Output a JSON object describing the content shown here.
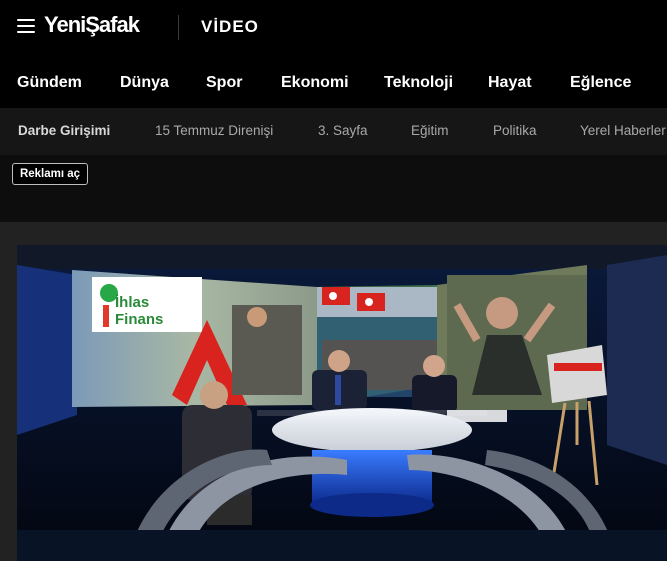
{
  "header": {
    "logo": "YeniŞafak",
    "section": "VİDEO"
  },
  "main_nav": [
    {
      "label": "Gündem"
    },
    {
      "label": "Dünya"
    },
    {
      "label": "Spor"
    },
    {
      "label": "Ekonomi"
    },
    {
      "label": "Teknoloji"
    },
    {
      "label": "Hayat"
    },
    {
      "label": "Eğlence"
    }
  ],
  "sub_nav": [
    {
      "label": "Darbe Girişimi",
      "active": true
    },
    {
      "label": "15 Temmuz Direnişi"
    },
    {
      "label": "3. Sayfa"
    },
    {
      "label": "Eğitim"
    },
    {
      "label": "Politika"
    },
    {
      "label": "Yerel Haberler"
    }
  ],
  "ad": {
    "button_label": "Reklamı aç"
  },
  "video": {
    "screen_text": "İhlas Finans"
  },
  "colors": {
    "background": "#1b1b1b",
    "topbar": "#000000",
    "subnav": "#161616",
    "accent_red": "#d8231f"
  }
}
